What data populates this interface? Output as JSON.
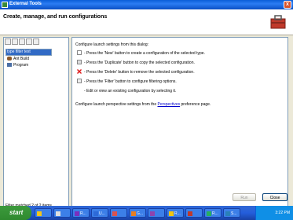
{
  "window": {
    "title": "External Tools",
    "close_glyph": "x"
  },
  "header": {
    "title": "Create, manage, and run configurations"
  },
  "left_panel": {
    "filter_text": "type filter text",
    "tree": [
      {
        "label": "Ant Build",
        "icon": "ant-icon"
      },
      {
        "label": "Program",
        "icon": "program-icon"
      }
    ],
    "status": "Filter matched 2 of 2 items"
  },
  "right_panel": {
    "intro": "Configure launch settings from this dialog:",
    "instructions": [
      {
        "icon": "new-icon",
        "text": "- Press the 'New' button to create a configuration of the selected type."
      },
      {
        "icon": "duplicate-icon",
        "text": "- Press the 'Duplicate' button to copy the selected configuration."
      },
      {
        "icon": "delete-icon",
        "text": "- Press the 'Delete' button to remove the selected configuration."
      },
      {
        "icon": "filter-icon",
        "text": "- Press the 'Filter' button to configure filtering options."
      },
      {
        "icon": "",
        "text": "- Edit or view an existing configuration by selecting it."
      }
    ],
    "perspective_prefix": "Configure launch perspective settings from the ",
    "perspective_link": "Perspectives",
    "perspective_suffix": " preference page."
  },
  "buttons": {
    "run": "Run",
    "close": "Close"
  },
  "taskbar": {
    "start": "start",
    "tasks": [
      {
        "label": ""
      },
      {
        "label": ""
      },
      {
        "label": "R..."
      },
      {
        "label": "U..."
      },
      {
        "label": ""
      },
      {
        "label": "G..."
      },
      {
        "label": ""
      },
      {
        "label": "R..."
      },
      {
        "label": ""
      },
      {
        "label": "R..."
      },
      {
        "label": "S..."
      }
    ],
    "clock": "3:22 PM"
  }
}
